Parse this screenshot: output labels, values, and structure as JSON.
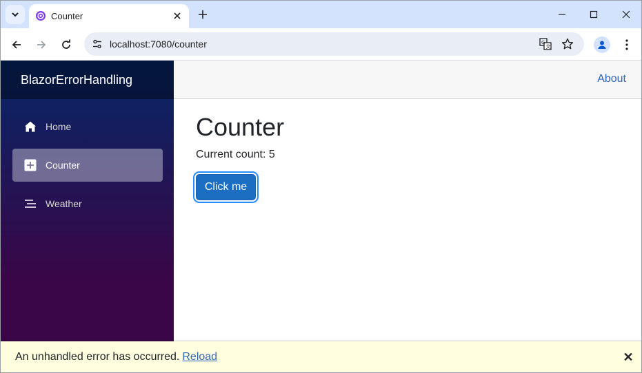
{
  "browser": {
    "tab_title": "Counter",
    "url": "localhost:7080/counter"
  },
  "app": {
    "brand": "BlazorErrorHandling",
    "nav": [
      {
        "label": "Home",
        "icon": "home-icon"
      },
      {
        "label": "Counter",
        "icon": "plus-icon"
      },
      {
        "label": "Weather",
        "icon": "list-icon"
      }
    ],
    "top_link": "About"
  },
  "counter": {
    "heading": "Counter",
    "count_label": "Current count: 5",
    "button_label": "Click me"
  },
  "error": {
    "message": "An unhandled error has occurred.",
    "reload": "Reload",
    "dismiss": "✕"
  },
  "colors": {
    "accent": "#1b6ec2",
    "link": "#3066b8",
    "error_bg": "#ffffe0"
  }
}
